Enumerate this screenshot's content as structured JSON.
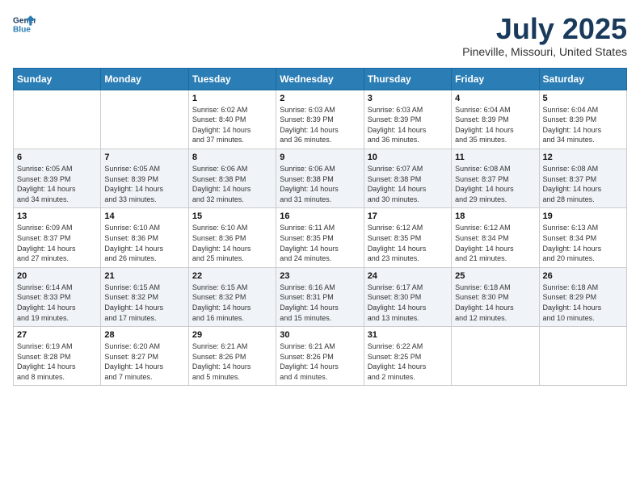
{
  "header": {
    "logo_line1": "General",
    "logo_line2": "Blue",
    "title": "July 2025",
    "location": "Pineville, Missouri, United States"
  },
  "weekdays": [
    "Sunday",
    "Monday",
    "Tuesday",
    "Wednesday",
    "Thursday",
    "Friday",
    "Saturday"
  ],
  "weeks": [
    [
      {
        "day": "",
        "info": ""
      },
      {
        "day": "",
        "info": ""
      },
      {
        "day": "1",
        "info": "Sunrise: 6:02 AM\nSunset: 8:40 PM\nDaylight: 14 hours\nand 37 minutes."
      },
      {
        "day": "2",
        "info": "Sunrise: 6:03 AM\nSunset: 8:39 PM\nDaylight: 14 hours\nand 36 minutes."
      },
      {
        "day": "3",
        "info": "Sunrise: 6:03 AM\nSunset: 8:39 PM\nDaylight: 14 hours\nand 36 minutes."
      },
      {
        "day": "4",
        "info": "Sunrise: 6:04 AM\nSunset: 8:39 PM\nDaylight: 14 hours\nand 35 minutes."
      },
      {
        "day": "5",
        "info": "Sunrise: 6:04 AM\nSunset: 8:39 PM\nDaylight: 14 hours\nand 34 minutes."
      }
    ],
    [
      {
        "day": "6",
        "info": "Sunrise: 6:05 AM\nSunset: 8:39 PM\nDaylight: 14 hours\nand 34 minutes."
      },
      {
        "day": "7",
        "info": "Sunrise: 6:05 AM\nSunset: 8:39 PM\nDaylight: 14 hours\nand 33 minutes."
      },
      {
        "day": "8",
        "info": "Sunrise: 6:06 AM\nSunset: 8:38 PM\nDaylight: 14 hours\nand 32 minutes."
      },
      {
        "day": "9",
        "info": "Sunrise: 6:06 AM\nSunset: 8:38 PM\nDaylight: 14 hours\nand 31 minutes."
      },
      {
        "day": "10",
        "info": "Sunrise: 6:07 AM\nSunset: 8:38 PM\nDaylight: 14 hours\nand 30 minutes."
      },
      {
        "day": "11",
        "info": "Sunrise: 6:08 AM\nSunset: 8:37 PM\nDaylight: 14 hours\nand 29 minutes."
      },
      {
        "day": "12",
        "info": "Sunrise: 6:08 AM\nSunset: 8:37 PM\nDaylight: 14 hours\nand 28 minutes."
      }
    ],
    [
      {
        "day": "13",
        "info": "Sunrise: 6:09 AM\nSunset: 8:37 PM\nDaylight: 14 hours\nand 27 minutes."
      },
      {
        "day": "14",
        "info": "Sunrise: 6:10 AM\nSunset: 8:36 PM\nDaylight: 14 hours\nand 26 minutes."
      },
      {
        "day": "15",
        "info": "Sunrise: 6:10 AM\nSunset: 8:36 PM\nDaylight: 14 hours\nand 25 minutes."
      },
      {
        "day": "16",
        "info": "Sunrise: 6:11 AM\nSunset: 8:35 PM\nDaylight: 14 hours\nand 24 minutes."
      },
      {
        "day": "17",
        "info": "Sunrise: 6:12 AM\nSunset: 8:35 PM\nDaylight: 14 hours\nand 23 minutes."
      },
      {
        "day": "18",
        "info": "Sunrise: 6:12 AM\nSunset: 8:34 PM\nDaylight: 14 hours\nand 21 minutes."
      },
      {
        "day": "19",
        "info": "Sunrise: 6:13 AM\nSunset: 8:34 PM\nDaylight: 14 hours\nand 20 minutes."
      }
    ],
    [
      {
        "day": "20",
        "info": "Sunrise: 6:14 AM\nSunset: 8:33 PM\nDaylight: 14 hours\nand 19 minutes."
      },
      {
        "day": "21",
        "info": "Sunrise: 6:15 AM\nSunset: 8:32 PM\nDaylight: 14 hours\nand 17 minutes."
      },
      {
        "day": "22",
        "info": "Sunrise: 6:15 AM\nSunset: 8:32 PM\nDaylight: 14 hours\nand 16 minutes."
      },
      {
        "day": "23",
        "info": "Sunrise: 6:16 AM\nSunset: 8:31 PM\nDaylight: 14 hours\nand 15 minutes."
      },
      {
        "day": "24",
        "info": "Sunrise: 6:17 AM\nSunset: 8:30 PM\nDaylight: 14 hours\nand 13 minutes."
      },
      {
        "day": "25",
        "info": "Sunrise: 6:18 AM\nSunset: 8:30 PM\nDaylight: 14 hours\nand 12 minutes."
      },
      {
        "day": "26",
        "info": "Sunrise: 6:18 AM\nSunset: 8:29 PM\nDaylight: 14 hours\nand 10 minutes."
      }
    ],
    [
      {
        "day": "27",
        "info": "Sunrise: 6:19 AM\nSunset: 8:28 PM\nDaylight: 14 hours\nand 8 minutes."
      },
      {
        "day": "28",
        "info": "Sunrise: 6:20 AM\nSunset: 8:27 PM\nDaylight: 14 hours\nand 7 minutes."
      },
      {
        "day": "29",
        "info": "Sunrise: 6:21 AM\nSunset: 8:26 PM\nDaylight: 14 hours\nand 5 minutes."
      },
      {
        "day": "30",
        "info": "Sunrise: 6:21 AM\nSunset: 8:26 PM\nDaylight: 14 hours\nand 4 minutes."
      },
      {
        "day": "31",
        "info": "Sunrise: 6:22 AM\nSunset: 8:25 PM\nDaylight: 14 hours\nand 2 minutes."
      },
      {
        "day": "",
        "info": ""
      },
      {
        "day": "",
        "info": ""
      }
    ]
  ]
}
